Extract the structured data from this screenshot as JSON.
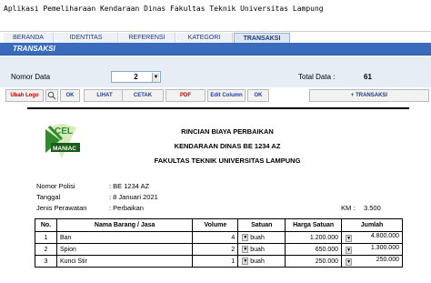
{
  "window": {
    "title": "Aplikasi Pemeliharaan Kendaraan Dinas Fakultas Teknik Universitas Lampung"
  },
  "tabs": [
    {
      "label": "BERANDA"
    },
    {
      "label": "IDENTITAS"
    },
    {
      "label": "REFERENSI"
    },
    {
      "label": "KATEGORI"
    },
    {
      "label": "TRANSAKSI",
      "active": true
    }
  ],
  "section": {
    "label": "TRANSAKSI"
  },
  "controls": {
    "nomor_label": "Nomor Data",
    "nomor_value": "2",
    "total_label": "Total Data :",
    "total_value": "61",
    "dropdown_arrow": "▼"
  },
  "toolbar": {
    "ubah_logo": "Ubah Logo",
    "ok1": "OK",
    "lihat": "LIHAT",
    "cetak": "CETAK",
    "pdf": "PDF",
    "edit_column": "Edit Column",
    "ok2": "OK",
    "add_transaksi": "+ TRANSAKSI",
    "search_icon": "magnifier-icon"
  },
  "document": {
    "logo_text_top": "CEL",
    "logo_text_bottom": "MANIAC",
    "heading1": "RINCIAN BIAYA PERBAIKAN",
    "heading2": "KENDARAAN DINAS BE 1234 AZ",
    "heading3": "FAKULTAS TEKNIK UNIVERSITAS LAMPUNG",
    "nopol_label": "Nomor Polisi",
    "nopol_value": ": BE 1234 AZ",
    "tanggal_label": "Tanggal",
    "tanggal_value": ": 8 Januari 2021",
    "jenis_label": "Jenis Perawatan",
    "jenis_value": ": Perbaikan",
    "km_label": "KM :",
    "km_value": "3.500",
    "table": {
      "headers": [
        "No.",
        "Nama Barang / Jasa",
        "Volume",
        "Satuan",
        "Harga Satuan",
        "Jumlah"
      ],
      "rows": [
        {
          "no": "1",
          "nama": "Ban",
          "volume": "4",
          "satuan": "buah",
          "harga": "1.200.000",
          "jumlah": "4.800.000"
        },
        {
          "no": "2",
          "nama": "Spion",
          "volume": "2",
          "satuan": "buah",
          "harga": "650.000",
          "jumlah": "1.300.000"
        },
        {
          "no": "3",
          "nama": "Kunci Stir",
          "volume": "1",
          "satuan": "buah",
          "harga": "250.000",
          "jumlah": "250.000"
        }
      ]
    }
  },
  "colors": {
    "accent_blue": "#3a6bbd",
    "red_text": "#c00000",
    "logo_green": "#2e8b2e"
  }
}
